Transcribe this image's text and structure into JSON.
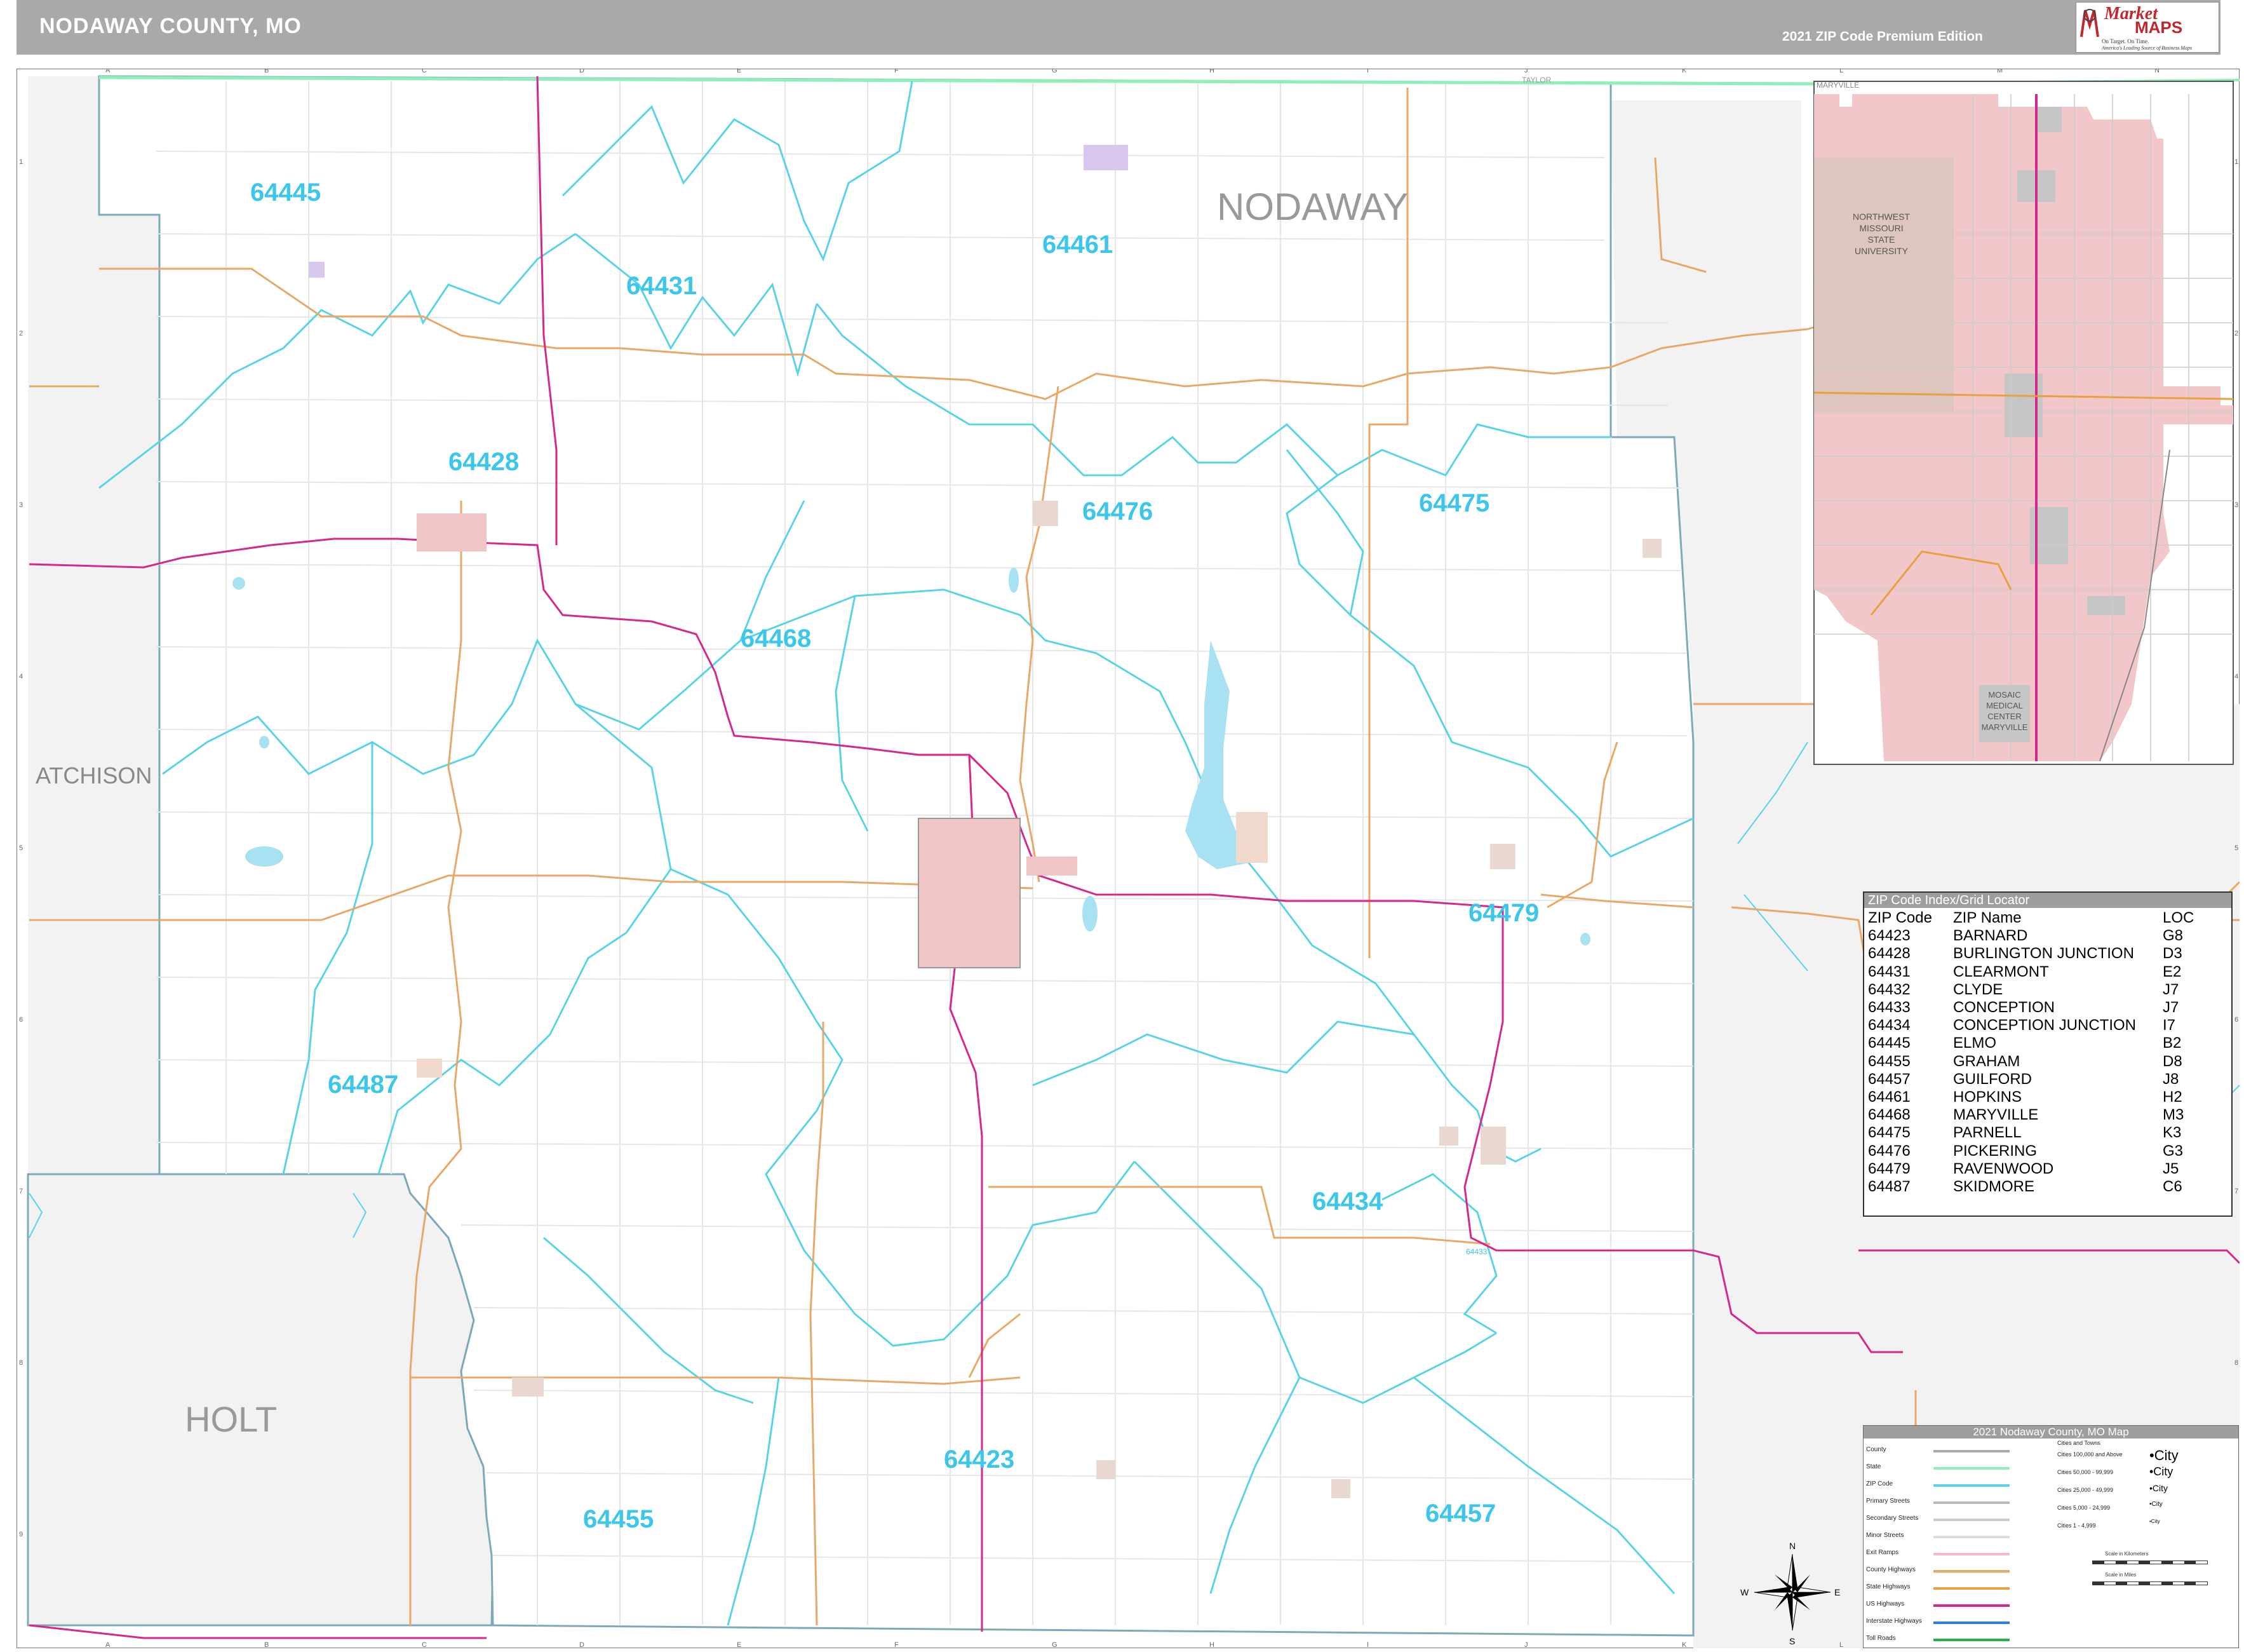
{
  "header": {
    "title": "NODAWAY COUNTY, MO",
    "edition": "2021 ZIP Code Premium Edition",
    "logo_top": "Market",
    "logo_bottom": "MAPS",
    "logo_tag1": "On Target. On Time.",
    "logo_tag2": "America's Leading Source of Business Maps"
  },
  "grid": {
    "columns": [
      "A",
      "B",
      "C",
      "D",
      "E",
      "F",
      "G",
      "H",
      "I",
      "J",
      "K",
      "L",
      "M",
      "N"
    ],
    "rows": [
      "1",
      "2",
      "3",
      "4",
      "5",
      "6",
      "7",
      "8",
      "9"
    ]
  },
  "regions": {
    "nodaway": "NODAWAY",
    "atchison": "ATCHISON",
    "holt": "HOLT",
    "taylor": "TAYLOR"
  },
  "zip_labels": [
    {
      "zip": "64445"
    },
    {
      "zip": "64461"
    },
    {
      "zip": "64431"
    },
    {
      "zip": "64428"
    },
    {
      "zip": "64476"
    },
    {
      "zip": "64475"
    },
    {
      "zip": "64468"
    },
    {
      "zip": "64479"
    },
    {
      "zip": "64487"
    },
    {
      "zip": "64434"
    },
    {
      "zip": "64423"
    },
    {
      "zip": "64455"
    },
    {
      "zip": "64457"
    }
  ],
  "small_zip": "64433",
  "inset": {
    "label_top": "MARYVILLE",
    "university": [
      "NORTHWEST",
      "MISSOURI",
      "STATE",
      "UNIVERSITY"
    ],
    "medical": [
      "MOSAIC",
      "MEDICAL",
      "CENTER",
      "MARYVILLE"
    ]
  },
  "zip_index": {
    "title": "ZIP Code Index/Grid Locator",
    "headers": [
      "ZIP Code",
      "ZIP Name",
      "LOC"
    ],
    "rows": [
      [
        "64423",
        "BARNARD",
        "G8"
      ],
      [
        "64428",
        "BURLINGTON JUNCTION",
        "D3"
      ],
      [
        "64431",
        "CLEARMONT",
        "E2"
      ],
      [
        "64432",
        "CLYDE",
        "J7"
      ],
      [
        "64433",
        "CONCEPTION",
        "J7"
      ],
      [
        "64434",
        "CONCEPTION JUNCTION",
        "I7"
      ],
      [
        "64445",
        "ELMO",
        "B2"
      ],
      [
        "64455",
        "GRAHAM",
        "D8"
      ],
      [
        "64457",
        "GUILFORD",
        "J8"
      ],
      [
        "64461",
        "HOPKINS",
        "H2"
      ],
      [
        "64468",
        "MARYVILLE",
        "M3"
      ],
      [
        "64475",
        "PARNELL",
        "K3"
      ],
      [
        "64476",
        "PICKERING",
        "G3"
      ],
      [
        "64479",
        "RAVENWOOD",
        "J5"
      ],
      [
        "64487",
        "SKIDMORE",
        "C6"
      ]
    ]
  },
  "map_legend": {
    "title": "2021 Nodaway County, MO Map",
    "items": [
      "County",
      "State",
      "ZIP Code",
      "Primary Streets",
      "Secondary Streets",
      "Minor Streets",
      "Exit Ramps",
      "County Highways",
      "State Highways",
      "US Highways",
      "Interstate Highways",
      "Toll Roads"
    ],
    "line_colors": [
      "#aaaaaa",
      "#8ef0b8",
      "#5ad3e6",
      "#bbbbbb",
      "#cccccc",
      "#dddddd",
      "#f4b8c8",
      "#e8a868",
      "#e8a040",
      "#d4288a",
      "#2e7fd0",
      "#2ab04a"
    ],
    "cities_title": "Cities and Towns",
    "city_sizes": [
      "Cities 100,000 and Above",
      "Cities 50,000 - 99,999",
      "Cities 25,000 - 49,999",
      "Cities 5,000 - 24,999",
      "Cities 1 - 4,999"
    ],
    "city_samples": [
      "City",
      "City",
      "City",
      "City",
      "City"
    ],
    "scale_km": "Scale in Kilometers",
    "scale_mi": "Scale in Miles"
  },
  "compass": {
    "n": "N",
    "s": "S",
    "e": "E",
    "w": "W"
  }
}
